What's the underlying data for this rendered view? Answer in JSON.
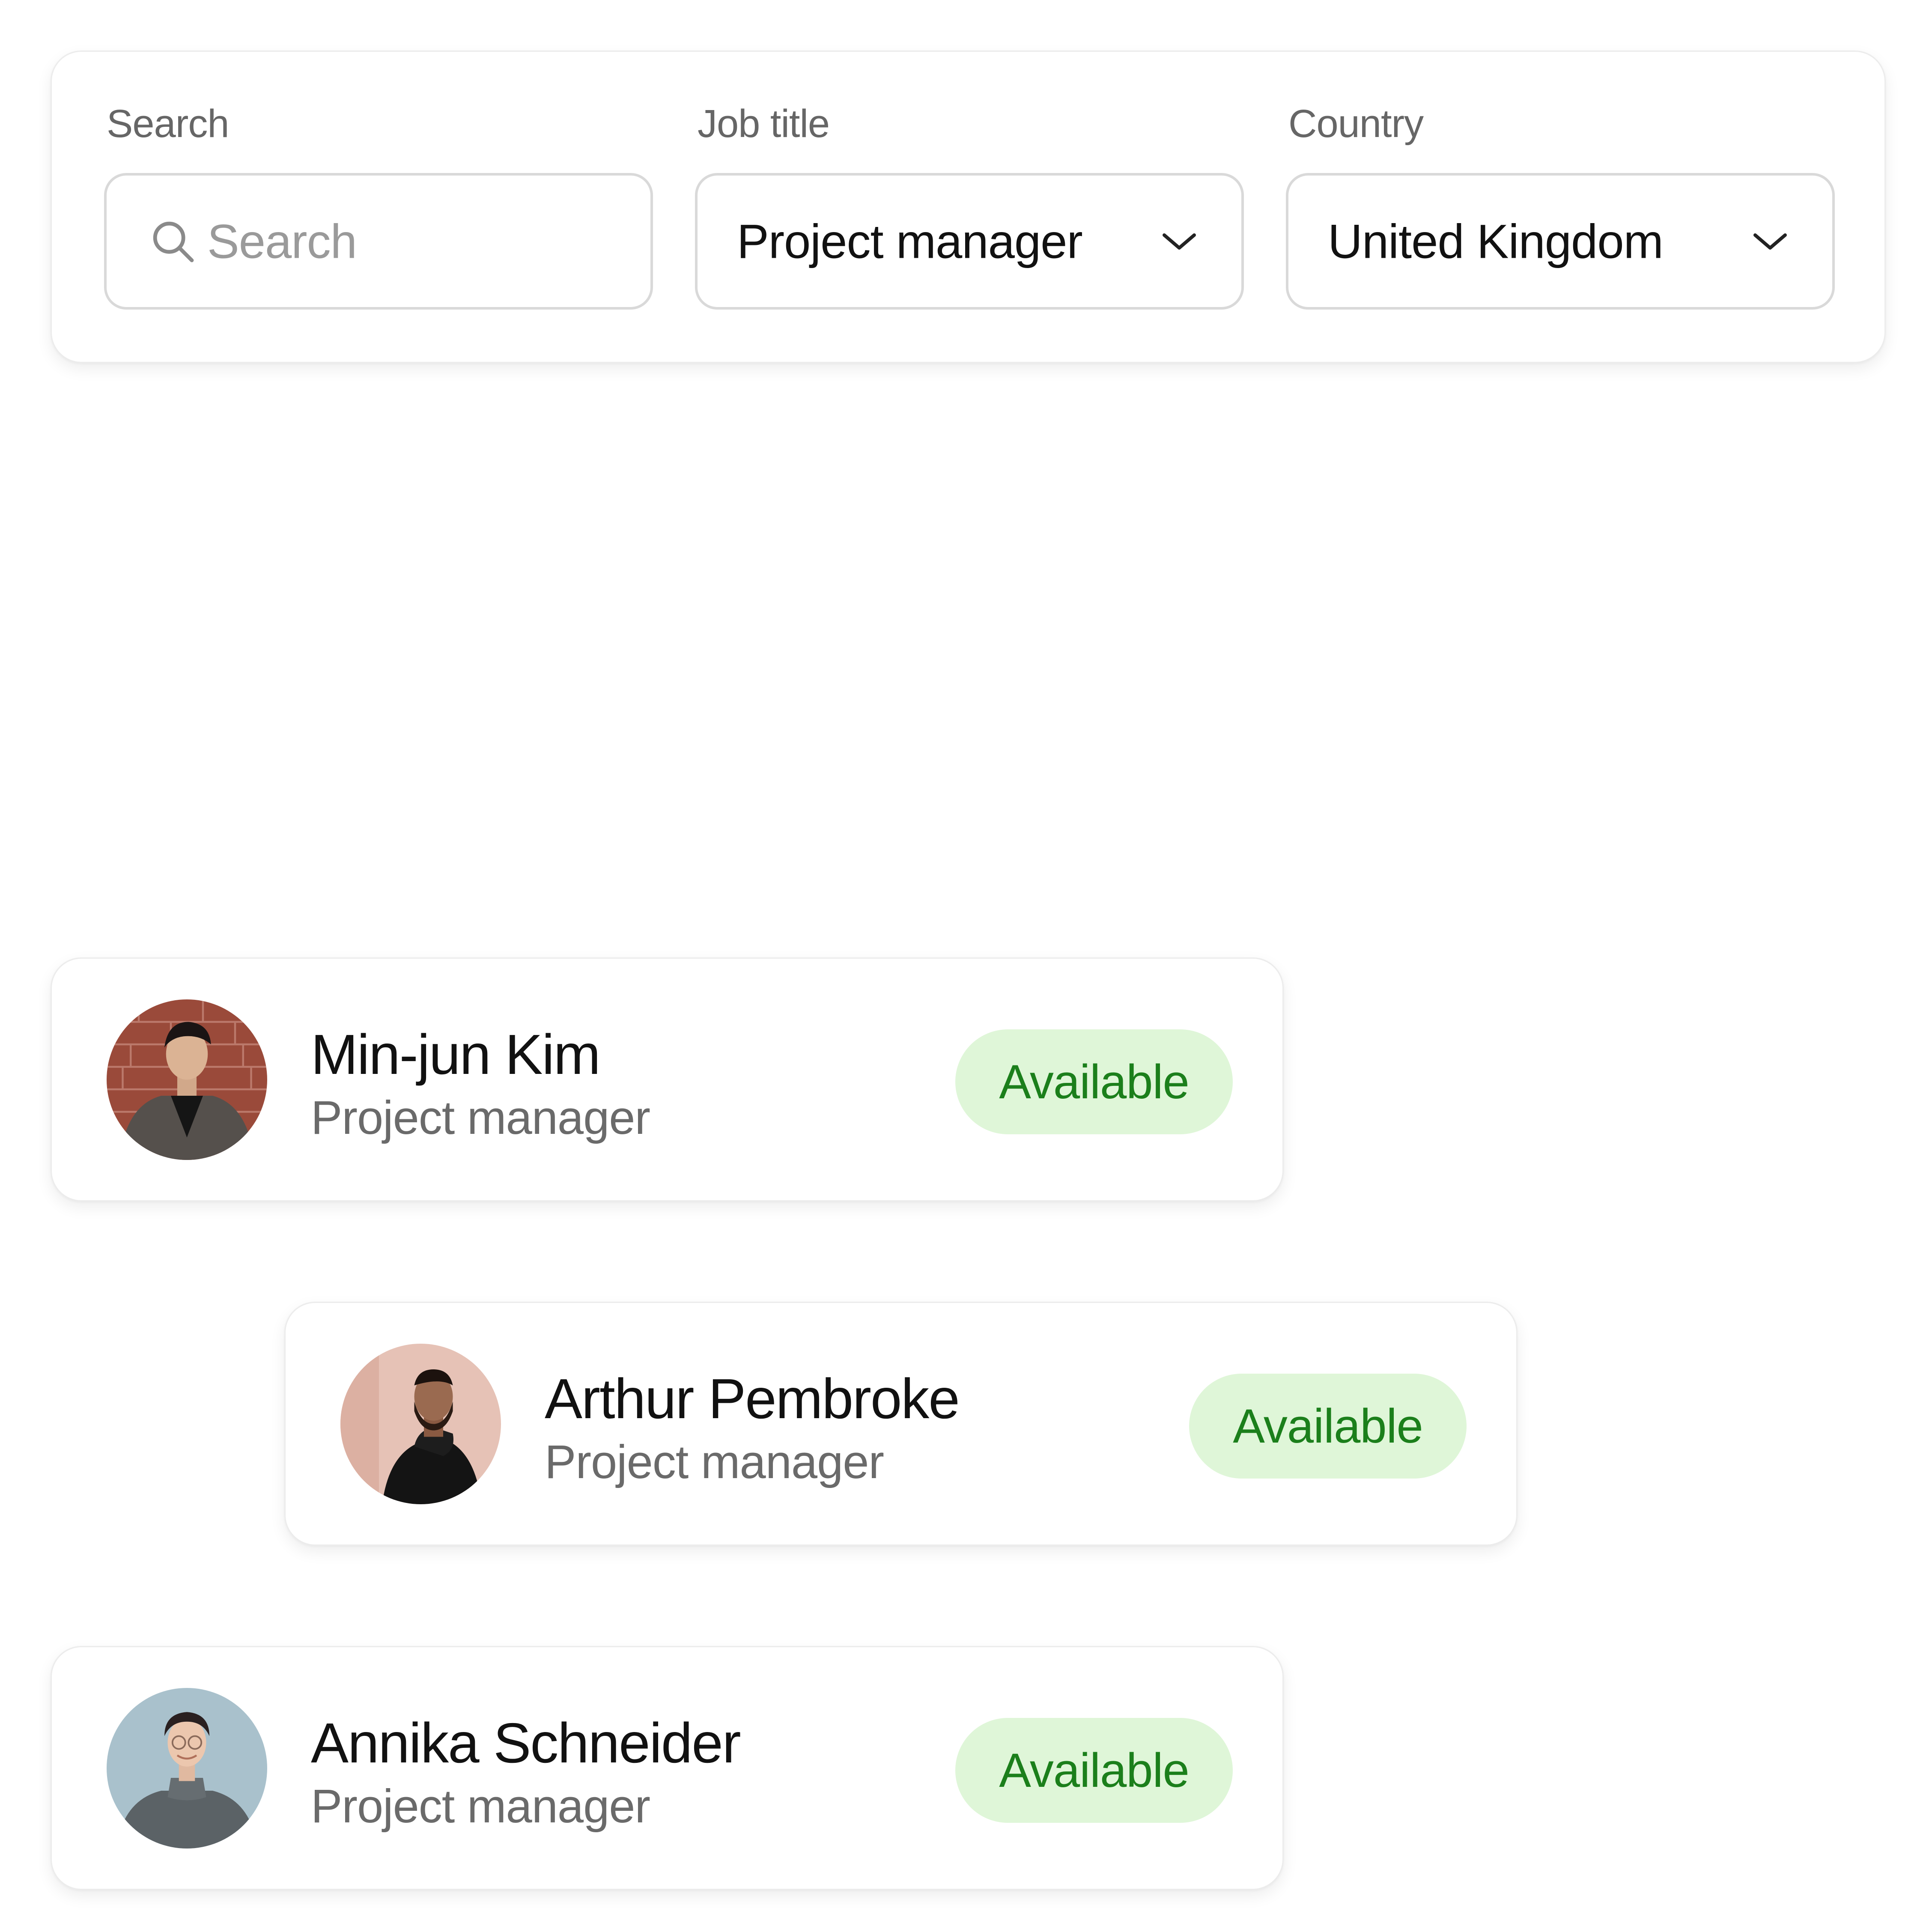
{
  "filters": {
    "search": {
      "label": "Search",
      "placeholder": "Search",
      "value": ""
    },
    "job_title": {
      "label": "Job title",
      "selected": "Project manager"
    },
    "country": {
      "label": "Country",
      "selected": "United Kingdom"
    }
  },
  "people": [
    {
      "name": "Min-jun Kim",
      "role": "Project manager",
      "status": "Available"
    },
    {
      "name": "Arthur Pembroke",
      "role": "Project manager",
      "status": "Available"
    },
    {
      "name": "Annika Schneider",
      "role": "Project manager",
      "status": "Available"
    }
  ],
  "icons": {
    "search": "search-icon",
    "dropdown": "chevron-down-icon",
    "avatar": "avatar-photo"
  },
  "colors": {
    "status_bg": "#dff6d8",
    "status_text": "#1b7f1b",
    "label_text": "#666666",
    "placeholder_text": "#9a9a9a",
    "border": "#d9d9d9"
  }
}
